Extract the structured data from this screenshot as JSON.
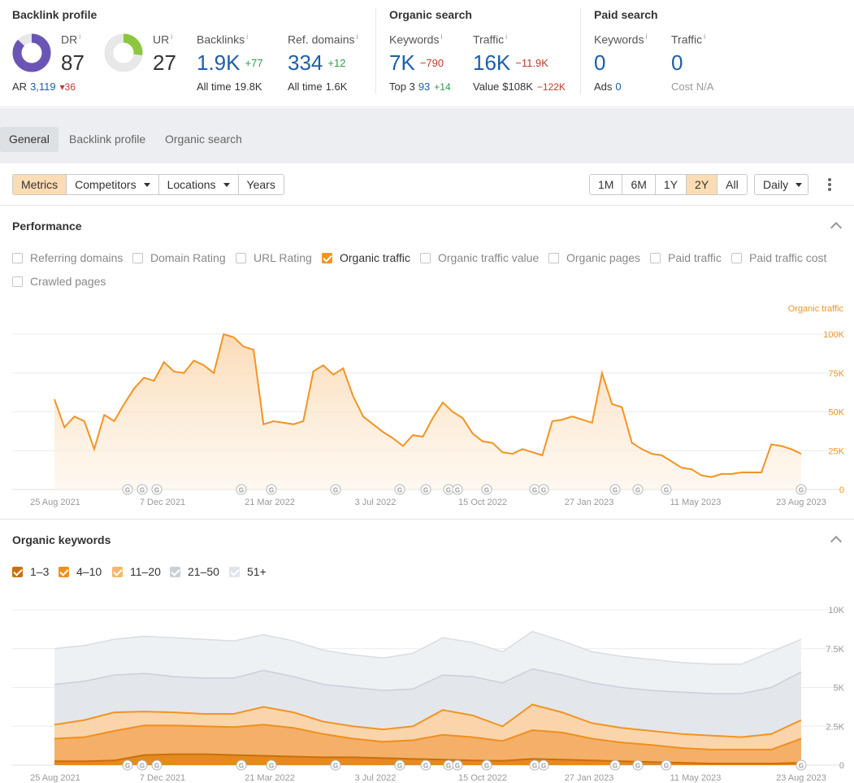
{
  "backlink_profile": {
    "title": "Backlink profile",
    "dr": {
      "label": "DR",
      "value": "87",
      "ratio": 0.87
    },
    "ur": {
      "label": "UR",
      "value": "27",
      "ratio": 0.27
    },
    "ar": {
      "label": "AR",
      "value": "3,119",
      "delta": "36"
    },
    "backlinks": {
      "label": "Backlinks",
      "value": "1.9K",
      "delta": "+77",
      "alltime_label": "All time",
      "alltime_value": "19.8K"
    },
    "ref_domains": {
      "label": "Ref. domains",
      "value": "334",
      "delta": "+12",
      "alltime_label": "All time",
      "alltime_value": "1.6K"
    },
    "info_mark": "i"
  },
  "organic_search": {
    "title": "Organic search",
    "keywords": {
      "label": "Keywords",
      "value": "7K",
      "delta": "−790",
      "sub_label": "Top 3",
      "sub_value": "93",
      "sub_delta": "+14"
    },
    "traffic": {
      "label": "Traffic",
      "value": "16K",
      "delta": "−11.9K",
      "sub_label": "Value",
      "sub_value": "$108K",
      "sub_delta": "−122K"
    }
  },
  "paid_search": {
    "title": "Paid search",
    "keywords": {
      "label": "Keywords",
      "value": "0",
      "sub_label": "Ads",
      "sub_value": "0"
    },
    "traffic": {
      "label": "Traffic",
      "value": "0",
      "sub_label": "Cost",
      "sub_value": "N/A"
    }
  },
  "tabs": [
    "General",
    "Backlink profile",
    "Organic search"
  ],
  "toolbar": {
    "left": [
      "Metrics",
      "Competitors",
      "Locations",
      "Years"
    ],
    "ranges": [
      "1M",
      "6M",
      "1Y",
      "2Y",
      "All"
    ],
    "interval": "Daily"
  },
  "performance": {
    "title": "Performance",
    "checkboxes": [
      "Referring domains",
      "Domain Rating",
      "URL Rating",
      "Organic traffic",
      "Organic traffic value",
      "Organic pages",
      "Paid traffic",
      "Paid traffic cost",
      "Crawled pages"
    ]
  },
  "organic_keywords": {
    "title": "Organic keywords",
    "legend": [
      "1–3",
      "4–10",
      "11–20",
      "21–50",
      "51+"
    ]
  },
  "colors": {
    "accent": "#f29423",
    "blue": "#1f5fa8",
    "dr_ring": "#6a55b4",
    "ur_ring": "#8cc63f"
  },
  "google_marker": "G",
  "chart_data": [
    {
      "type": "area",
      "series": [
        {
          "name": "Organic traffic",
          "values": [
            58000,
            40000,
            47000,
            44000,
            26000,
            48000,
            44000,
            55000,
            65000,
            72000,
            70000,
            82000,
            76000,
            75000,
            83000,
            80000,
            75000,
            100000,
            98000,
            92000,
            90000,
            42000,
            44000,
            43000,
            42000,
            44000,
            76000,
            80000,
            74000,
            78000,
            60000,
            47000,
            42000,
            37000,
            33000,
            28000,
            35000,
            34000,
            46000,
            56000,
            50000,
            46000,
            36000,
            31000,
            30000,
            24000,
            23000,
            26000,
            24000,
            22000,
            44000,
            45000,
            47000,
            45000,
            43000,
            75000,
            55000,
            53000,
            30000,
            26000,
            23000,
            22000,
            18000,
            14000,
            13000,
            9000,
            8000,
            10000,
            10000,
            11000,
            11000,
            11000,
            29000,
            28000,
            26000,
            23000
          ]
        }
      ],
      "x_tick_labels": [
        "25 Aug 2021",
        "7 Dec 2021",
        "21 Mar 2022",
        "3 Jul 2022",
        "15 Oct 2022",
        "27 Jan 2023",
        "11 May 2023",
        "23 Aug 2023"
      ],
      "y_tick_labels": [
        "100K",
        "75K",
        "50K",
        "25K",
        "0"
      ],
      "ylabel": "Organic traffic",
      "ylim": [
        0,
        100000
      ],
      "grid": true
    },
    {
      "type": "area",
      "stacked": true,
      "series": [
        {
          "name": "1–3",
          "values": [
            250,
            250,
            300,
            650,
            700,
            700,
            650,
            600,
            550,
            500,
            500,
            450,
            400,
            350,
            300,
            280,
            400,
            350,
            300,
            250,
            200,
            150,
            100,
            100,
            100,
            150
          ]
        },
        {
          "name": "4–10",
          "values": [
            1700,
            1800,
            2200,
            2550,
            2550,
            2500,
            2450,
            2600,
            2400,
            2000,
            1700,
            1500,
            1600,
            1950,
            1800,
            1550,
            2250,
            2100,
            1700,
            1450,
            1300,
            1100,
            1000,
            1000,
            1000,
            1700
          ]
        },
        {
          "name": "11–20",
          "values": [
            2600,
            2900,
            3400,
            3450,
            3400,
            3300,
            3300,
            3750,
            3400,
            2800,
            2500,
            2300,
            2500,
            3550,
            3200,
            2500,
            3900,
            3400,
            2700,
            2400,
            2200,
            2000,
            1900,
            1800,
            2000,
            2900
          ]
        },
        {
          "name": "21–50",
          "values": [
            5200,
            5400,
            5800,
            5900,
            5700,
            5600,
            5600,
            6100,
            5700,
            5200,
            5000,
            4800,
            4900,
            5800,
            5700,
            5300,
            6200,
            5800,
            5300,
            5000,
            4800,
            4700,
            4600,
            4600,
            5000,
            6000
          ]
        },
        {
          "name": "51+",
          "values": [
            7500,
            7700,
            8100,
            8300,
            8200,
            8100,
            8000,
            8400,
            8000,
            7400,
            7100,
            6900,
            7200,
            8200,
            7900,
            7300,
            8600,
            8000,
            7300,
            7000,
            6800,
            6600,
            6500,
            6500,
            7300,
            8100
          ]
        }
      ],
      "x_tick_labels": [
        "25 Aug 2021",
        "7 Dec 2021",
        "21 Mar 2022",
        "3 Jul 2022",
        "15 Oct 2022",
        "27 Jan 2023",
        "11 May 2023",
        "23 Aug 2023"
      ],
      "y_tick_labels": [
        "10K",
        "7.5K",
        "5K",
        "2.5K",
        "0"
      ],
      "ylim": [
        0,
        10000
      ],
      "grid": true
    }
  ]
}
